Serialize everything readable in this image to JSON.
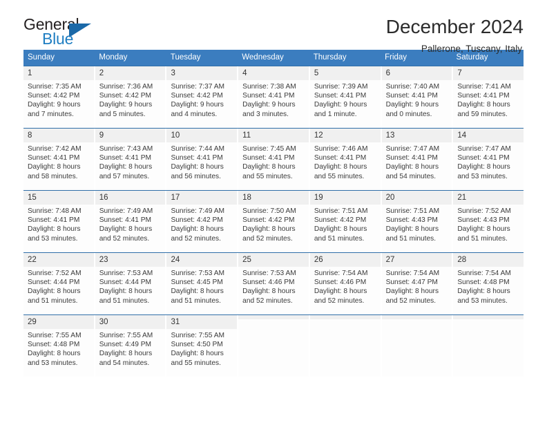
{
  "brand": {
    "name_top": "General",
    "name_bottom": "Blue",
    "accent_color": "#1f7ec2",
    "triangle_color": "#1b69a8"
  },
  "header": {
    "title": "December 2024",
    "subtitle": "Pallerone, Tuscany, Italy"
  },
  "calendar": {
    "header_background": "#3b7dbf",
    "day_band_background": "#f0f0f0",
    "weekdays": [
      "Sunday",
      "Monday",
      "Tuesday",
      "Wednesday",
      "Thursday",
      "Friday",
      "Saturday"
    ],
    "weeks": [
      [
        {
          "day": "1",
          "sunrise": "Sunrise: 7:35 AM",
          "sunset": "Sunset: 4:42 PM",
          "daylight_line1": "Daylight: 9 hours",
          "daylight_line2": "and 7 minutes."
        },
        {
          "day": "2",
          "sunrise": "Sunrise: 7:36 AM",
          "sunset": "Sunset: 4:42 PM",
          "daylight_line1": "Daylight: 9 hours",
          "daylight_line2": "and 5 minutes."
        },
        {
          "day": "3",
          "sunrise": "Sunrise: 7:37 AM",
          "sunset": "Sunset: 4:42 PM",
          "daylight_line1": "Daylight: 9 hours",
          "daylight_line2": "and 4 minutes."
        },
        {
          "day": "4",
          "sunrise": "Sunrise: 7:38 AM",
          "sunset": "Sunset: 4:41 PM",
          "daylight_line1": "Daylight: 9 hours",
          "daylight_line2": "and 3 minutes."
        },
        {
          "day": "5",
          "sunrise": "Sunrise: 7:39 AM",
          "sunset": "Sunset: 4:41 PM",
          "daylight_line1": "Daylight: 9 hours",
          "daylight_line2": "and 1 minute."
        },
        {
          "day": "6",
          "sunrise": "Sunrise: 7:40 AM",
          "sunset": "Sunset: 4:41 PM",
          "daylight_line1": "Daylight: 9 hours",
          "daylight_line2": "and 0 minutes."
        },
        {
          "day": "7",
          "sunrise": "Sunrise: 7:41 AM",
          "sunset": "Sunset: 4:41 PM",
          "daylight_line1": "Daylight: 8 hours",
          "daylight_line2": "and 59 minutes."
        }
      ],
      [
        {
          "day": "8",
          "sunrise": "Sunrise: 7:42 AM",
          "sunset": "Sunset: 4:41 PM",
          "daylight_line1": "Daylight: 8 hours",
          "daylight_line2": "and 58 minutes."
        },
        {
          "day": "9",
          "sunrise": "Sunrise: 7:43 AM",
          "sunset": "Sunset: 4:41 PM",
          "daylight_line1": "Daylight: 8 hours",
          "daylight_line2": "and 57 minutes."
        },
        {
          "day": "10",
          "sunrise": "Sunrise: 7:44 AM",
          "sunset": "Sunset: 4:41 PM",
          "daylight_line1": "Daylight: 8 hours",
          "daylight_line2": "and 56 minutes."
        },
        {
          "day": "11",
          "sunrise": "Sunrise: 7:45 AM",
          "sunset": "Sunset: 4:41 PM",
          "daylight_line1": "Daylight: 8 hours",
          "daylight_line2": "and 55 minutes."
        },
        {
          "day": "12",
          "sunrise": "Sunrise: 7:46 AM",
          "sunset": "Sunset: 4:41 PM",
          "daylight_line1": "Daylight: 8 hours",
          "daylight_line2": "and 55 minutes."
        },
        {
          "day": "13",
          "sunrise": "Sunrise: 7:47 AM",
          "sunset": "Sunset: 4:41 PM",
          "daylight_line1": "Daylight: 8 hours",
          "daylight_line2": "and 54 minutes."
        },
        {
          "day": "14",
          "sunrise": "Sunrise: 7:47 AM",
          "sunset": "Sunset: 4:41 PM",
          "daylight_line1": "Daylight: 8 hours",
          "daylight_line2": "and 53 minutes."
        }
      ],
      [
        {
          "day": "15",
          "sunrise": "Sunrise: 7:48 AM",
          "sunset": "Sunset: 4:41 PM",
          "daylight_line1": "Daylight: 8 hours",
          "daylight_line2": "and 53 minutes."
        },
        {
          "day": "16",
          "sunrise": "Sunrise: 7:49 AM",
          "sunset": "Sunset: 4:41 PM",
          "daylight_line1": "Daylight: 8 hours",
          "daylight_line2": "and 52 minutes."
        },
        {
          "day": "17",
          "sunrise": "Sunrise: 7:49 AM",
          "sunset": "Sunset: 4:42 PM",
          "daylight_line1": "Daylight: 8 hours",
          "daylight_line2": "and 52 minutes."
        },
        {
          "day": "18",
          "sunrise": "Sunrise: 7:50 AM",
          "sunset": "Sunset: 4:42 PM",
          "daylight_line1": "Daylight: 8 hours",
          "daylight_line2": "and 52 minutes."
        },
        {
          "day": "19",
          "sunrise": "Sunrise: 7:51 AM",
          "sunset": "Sunset: 4:42 PM",
          "daylight_line1": "Daylight: 8 hours",
          "daylight_line2": "and 51 minutes."
        },
        {
          "day": "20",
          "sunrise": "Sunrise: 7:51 AM",
          "sunset": "Sunset: 4:43 PM",
          "daylight_line1": "Daylight: 8 hours",
          "daylight_line2": "and 51 minutes."
        },
        {
          "day": "21",
          "sunrise": "Sunrise: 7:52 AM",
          "sunset": "Sunset: 4:43 PM",
          "daylight_line1": "Daylight: 8 hours",
          "daylight_line2": "and 51 minutes."
        }
      ],
      [
        {
          "day": "22",
          "sunrise": "Sunrise: 7:52 AM",
          "sunset": "Sunset: 4:44 PM",
          "daylight_line1": "Daylight: 8 hours",
          "daylight_line2": "and 51 minutes."
        },
        {
          "day": "23",
          "sunrise": "Sunrise: 7:53 AM",
          "sunset": "Sunset: 4:44 PM",
          "daylight_line1": "Daylight: 8 hours",
          "daylight_line2": "and 51 minutes."
        },
        {
          "day": "24",
          "sunrise": "Sunrise: 7:53 AM",
          "sunset": "Sunset: 4:45 PM",
          "daylight_line1": "Daylight: 8 hours",
          "daylight_line2": "and 51 minutes."
        },
        {
          "day": "25",
          "sunrise": "Sunrise: 7:53 AM",
          "sunset": "Sunset: 4:46 PM",
          "daylight_line1": "Daylight: 8 hours",
          "daylight_line2": "and 52 minutes."
        },
        {
          "day": "26",
          "sunrise": "Sunrise: 7:54 AM",
          "sunset": "Sunset: 4:46 PM",
          "daylight_line1": "Daylight: 8 hours",
          "daylight_line2": "and 52 minutes."
        },
        {
          "day": "27",
          "sunrise": "Sunrise: 7:54 AM",
          "sunset": "Sunset: 4:47 PM",
          "daylight_line1": "Daylight: 8 hours",
          "daylight_line2": "and 52 minutes."
        },
        {
          "day": "28",
          "sunrise": "Sunrise: 7:54 AM",
          "sunset": "Sunset: 4:48 PM",
          "daylight_line1": "Daylight: 8 hours",
          "daylight_line2": "and 53 minutes."
        }
      ],
      [
        {
          "day": "29",
          "sunrise": "Sunrise: 7:55 AM",
          "sunset": "Sunset: 4:48 PM",
          "daylight_line1": "Daylight: 8 hours",
          "daylight_line2": "and 53 minutes."
        },
        {
          "day": "30",
          "sunrise": "Sunrise: 7:55 AM",
          "sunset": "Sunset: 4:49 PM",
          "daylight_line1": "Daylight: 8 hours",
          "daylight_line2": "and 54 minutes."
        },
        {
          "day": "31",
          "sunrise": "Sunrise: 7:55 AM",
          "sunset": "Sunset: 4:50 PM",
          "daylight_line1": "Daylight: 8 hours",
          "daylight_line2": "and 55 minutes."
        },
        {
          "day": "",
          "sunrise": "",
          "sunset": "",
          "daylight_line1": "",
          "daylight_line2": ""
        },
        {
          "day": "",
          "sunrise": "",
          "sunset": "",
          "daylight_line1": "",
          "daylight_line2": ""
        },
        {
          "day": "",
          "sunrise": "",
          "sunset": "",
          "daylight_line1": "",
          "daylight_line2": ""
        },
        {
          "day": "",
          "sunrise": "",
          "sunset": "",
          "daylight_line1": "",
          "daylight_line2": ""
        }
      ]
    ]
  }
}
